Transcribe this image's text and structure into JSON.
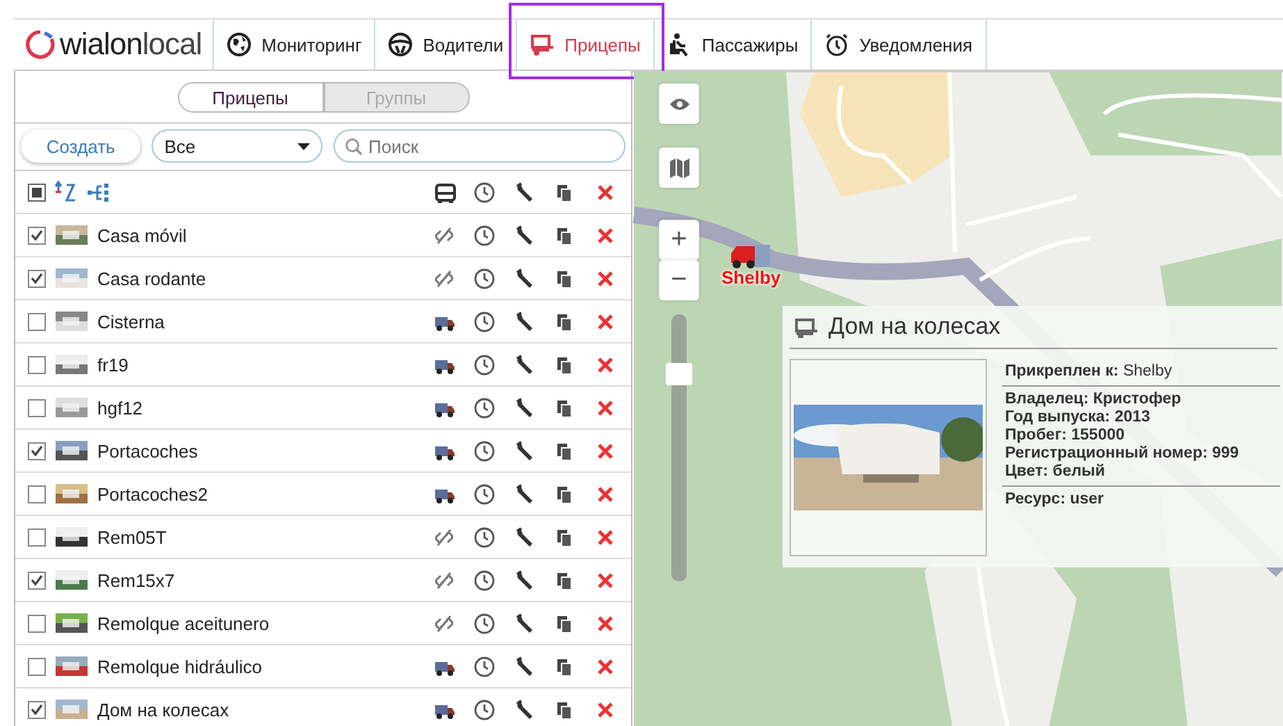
{
  "logo": {
    "part1": "wialon",
    "part2": "local"
  },
  "nav": [
    {
      "label": "Мониторинг",
      "selected": false
    },
    {
      "label": "Водители",
      "selected": false
    },
    {
      "label": "Прицепы",
      "selected": true
    },
    {
      "label": "Пассажиры",
      "selected": false
    },
    {
      "label": "Уведомления",
      "selected": false
    }
  ],
  "panel": {
    "segments": [
      {
        "label": "Прицепы",
        "selected": true
      },
      {
        "label": "Группы",
        "selected": false
      }
    ],
    "create_button": "Создать",
    "filter": {
      "value": "Все"
    },
    "search": {
      "placeholder": "Поиск"
    },
    "select_all_partial": true,
    "rows": [
      {
        "name": "Casa móvil",
        "checked": true,
        "attached": false
      },
      {
        "name": "Casa rodante",
        "checked": true,
        "attached": false
      },
      {
        "name": "Cisterna",
        "checked": false,
        "attached": true
      },
      {
        "name": "fr19",
        "checked": false,
        "attached": true
      },
      {
        "name": "hgf12",
        "checked": false,
        "attached": true
      },
      {
        "name": "Portacoches",
        "checked": true,
        "attached": true
      },
      {
        "name": "Portacoches2",
        "checked": false,
        "attached": true
      },
      {
        "name": "Rem05T",
        "checked": false,
        "attached": false
      },
      {
        "name": "Rem15x7",
        "checked": true,
        "attached": false
      },
      {
        "name": "Remolque aceitunero",
        "checked": false,
        "attached": false
      },
      {
        "name": "Remolque hidráulico",
        "checked": false,
        "attached": true
      },
      {
        "name": "Дом на колесах",
        "checked": true,
        "attached": true
      }
    ]
  },
  "map": {
    "zoom_in": "+",
    "zoom_out": "−",
    "zoom": {
      "level": 0.8
    },
    "marker": {
      "label": "Shelby"
    },
    "popup": {
      "title": "Дом на колесах",
      "sections": [
        {
          "lines": [
            "**Прикреплен к:** Shelby"
          ]
        },
        {
          "lines": [
            "Владелец: Кристофер",
            "Год выпуска: 2013",
            "Пробег: 155000",
            "Регистрационный номер: 999",
            "Цвет: белый"
          ]
        },
        {
          "lines": [
            "Ресурс: user"
          ]
        }
      ]
    }
  }
}
